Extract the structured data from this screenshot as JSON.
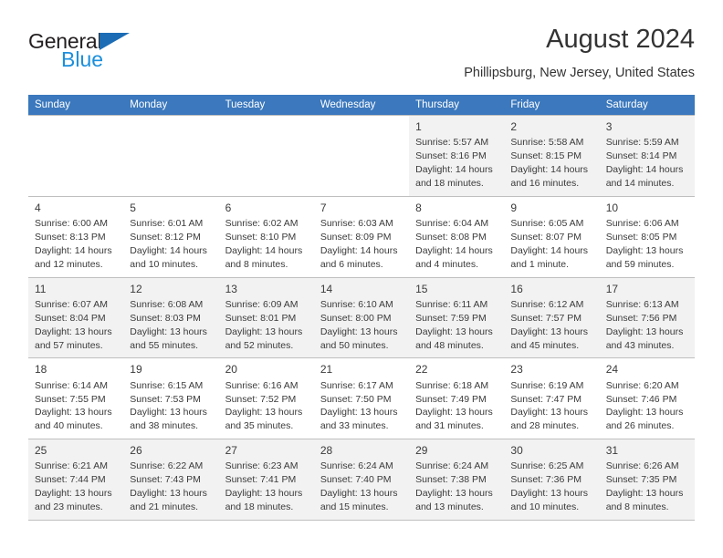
{
  "brand": {
    "name_part1": "General",
    "name_part2": "Blue",
    "colors": {
      "dark": "#231f20",
      "blue": "#1b8fdc",
      "triangle": "#1b6cb5"
    }
  },
  "header": {
    "title": "August 2024",
    "location": "Phillipsburg, New Jersey, United States"
  },
  "calendar": {
    "accent_color": "#3b78bd",
    "header_text_color": "#ffffff",
    "shaded_row_color": "#f2f2f2",
    "weekday_headers": [
      "Sunday",
      "Monday",
      "Tuesday",
      "Wednesday",
      "Thursday",
      "Friday",
      "Saturday"
    ],
    "weeks": [
      [
        {
          "day": "",
          "empty": true
        },
        {
          "day": "",
          "empty": true
        },
        {
          "day": "",
          "empty": true
        },
        {
          "day": "",
          "empty": true
        },
        {
          "day": "1",
          "sunrise": "Sunrise: 5:57 AM",
          "sunset": "Sunset: 8:16 PM",
          "daylight1": "Daylight: 14 hours",
          "daylight2": "and 18 minutes."
        },
        {
          "day": "2",
          "sunrise": "Sunrise: 5:58 AM",
          "sunset": "Sunset: 8:15 PM",
          "daylight1": "Daylight: 14 hours",
          "daylight2": "and 16 minutes."
        },
        {
          "day": "3",
          "sunrise": "Sunrise: 5:59 AM",
          "sunset": "Sunset: 8:14 PM",
          "daylight1": "Daylight: 14 hours",
          "daylight2": "and 14 minutes."
        }
      ],
      [
        {
          "day": "4",
          "sunrise": "Sunrise: 6:00 AM",
          "sunset": "Sunset: 8:13 PM",
          "daylight1": "Daylight: 14 hours",
          "daylight2": "and 12 minutes."
        },
        {
          "day": "5",
          "sunrise": "Sunrise: 6:01 AM",
          "sunset": "Sunset: 8:12 PM",
          "daylight1": "Daylight: 14 hours",
          "daylight2": "and 10 minutes."
        },
        {
          "day": "6",
          "sunrise": "Sunrise: 6:02 AM",
          "sunset": "Sunset: 8:10 PM",
          "daylight1": "Daylight: 14 hours",
          "daylight2": "and 8 minutes."
        },
        {
          "day": "7",
          "sunrise": "Sunrise: 6:03 AM",
          "sunset": "Sunset: 8:09 PM",
          "daylight1": "Daylight: 14 hours",
          "daylight2": "and 6 minutes."
        },
        {
          "day": "8",
          "sunrise": "Sunrise: 6:04 AM",
          "sunset": "Sunset: 8:08 PM",
          "daylight1": "Daylight: 14 hours",
          "daylight2": "and 4 minutes."
        },
        {
          "day": "9",
          "sunrise": "Sunrise: 6:05 AM",
          "sunset": "Sunset: 8:07 PM",
          "daylight1": "Daylight: 14 hours",
          "daylight2": "and 1 minute."
        },
        {
          "day": "10",
          "sunrise": "Sunrise: 6:06 AM",
          "sunset": "Sunset: 8:05 PM",
          "daylight1": "Daylight: 13 hours",
          "daylight2": "and 59 minutes."
        }
      ],
      [
        {
          "day": "11",
          "sunrise": "Sunrise: 6:07 AM",
          "sunset": "Sunset: 8:04 PM",
          "daylight1": "Daylight: 13 hours",
          "daylight2": "and 57 minutes."
        },
        {
          "day": "12",
          "sunrise": "Sunrise: 6:08 AM",
          "sunset": "Sunset: 8:03 PM",
          "daylight1": "Daylight: 13 hours",
          "daylight2": "and 55 minutes."
        },
        {
          "day": "13",
          "sunrise": "Sunrise: 6:09 AM",
          "sunset": "Sunset: 8:01 PM",
          "daylight1": "Daylight: 13 hours",
          "daylight2": "and 52 minutes."
        },
        {
          "day": "14",
          "sunrise": "Sunrise: 6:10 AM",
          "sunset": "Sunset: 8:00 PM",
          "daylight1": "Daylight: 13 hours",
          "daylight2": "and 50 minutes."
        },
        {
          "day": "15",
          "sunrise": "Sunrise: 6:11 AM",
          "sunset": "Sunset: 7:59 PM",
          "daylight1": "Daylight: 13 hours",
          "daylight2": "and 48 minutes."
        },
        {
          "day": "16",
          "sunrise": "Sunrise: 6:12 AM",
          "sunset": "Sunset: 7:57 PM",
          "daylight1": "Daylight: 13 hours",
          "daylight2": "and 45 minutes."
        },
        {
          "day": "17",
          "sunrise": "Sunrise: 6:13 AM",
          "sunset": "Sunset: 7:56 PM",
          "daylight1": "Daylight: 13 hours",
          "daylight2": "and 43 minutes."
        }
      ],
      [
        {
          "day": "18",
          "sunrise": "Sunrise: 6:14 AM",
          "sunset": "Sunset: 7:55 PM",
          "daylight1": "Daylight: 13 hours",
          "daylight2": "and 40 minutes."
        },
        {
          "day": "19",
          "sunrise": "Sunrise: 6:15 AM",
          "sunset": "Sunset: 7:53 PM",
          "daylight1": "Daylight: 13 hours",
          "daylight2": "and 38 minutes."
        },
        {
          "day": "20",
          "sunrise": "Sunrise: 6:16 AM",
          "sunset": "Sunset: 7:52 PM",
          "daylight1": "Daylight: 13 hours",
          "daylight2": "and 35 minutes."
        },
        {
          "day": "21",
          "sunrise": "Sunrise: 6:17 AM",
          "sunset": "Sunset: 7:50 PM",
          "daylight1": "Daylight: 13 hours",
          "daylight2": "and 33 minutes."
        },
        {
          "day": "22",
          "sunrise": "Sunrise: 6:18 AM",
          "sunset": "Sunset: 7:49 PM",
          "daylight1": "Daylight: 13 hours",
          "daylight2": "and 31 minutes."
        },
        {
          "day": "23",
          "sunrise": "Sunrise: 6:19 AM",
          "sunset": "Sunset: 7:47 PM",
          "daylight1": "Daylight: 13 hours",
          "daylight2": "and 28 minutes."
        },
        {
          "day": "24",
          "sunrise": "Sunrise: 6:20 AM",
          "sunset": "Sunset: 7:46 PM",
          "daylight1": "Daylight: 13 hours",
          "daylight2": "and 26 minutes."
        }
      ],
      [
        {
          "day": "25",
          "sunrise": "Sunrise: 6:21 AM",
          "sunset": "Sunset: 7:44 PM",
          "daylight1": "Daylight: 13 hours",
          "daylight2": "and 23 minutes."
        },
        {
          "day": "26",
          "sunrise": "Sunrise: 6:22 AM",
          "sunset": "Sunset: 7:43 PM",
          "daylight1": "Daylight: 13 hours",
          "daylight2": "and 21 minutes."
        },
        {
          "day": "27",
          "sunrise": "Sunrise: 6:23 AM",
          "sunset": "Sunset: 7:41 PM",
          "daylight1": "Daylight: 13 hours",
          "daylight2": "and 18 minutes."
        },
        {
          "day": "28",
          "sunrise": "Sunrise: 6:24 AM",
          "sunset": "Sunset: 7:40 PM",
          "daylight1": "Daylight: 13 hours",
          "daylight2": "and 15 minutes."
        },
        {
          "day": "29",
          "sunrise": "Sunrise: 6:24 AM",
          "sunset": "Sunset: 7:38 PM",
          "daylight1": "Daylight: 13 hours",
          "daylight2": "and 13 minutes."
        },
        {
          "day": "30",
          "sunrise": "Sunrise: 6:25 AM",
          "sunset": "Sunset: 7:36 PM",
          "daylight1": "Daylight: 13 hours",
          "daylight2": "and 10 minutes."
        },
        {
          "day": "31",
          "sunrise": "Sunrise: 6:26 AM",
          "sunset": "Sunset: 7:35 PM",
          "daylight1": "Daylight: 13 hours",
          "daylight2": "and 8 minutes."
        }
      ]
    ]
  }
}
